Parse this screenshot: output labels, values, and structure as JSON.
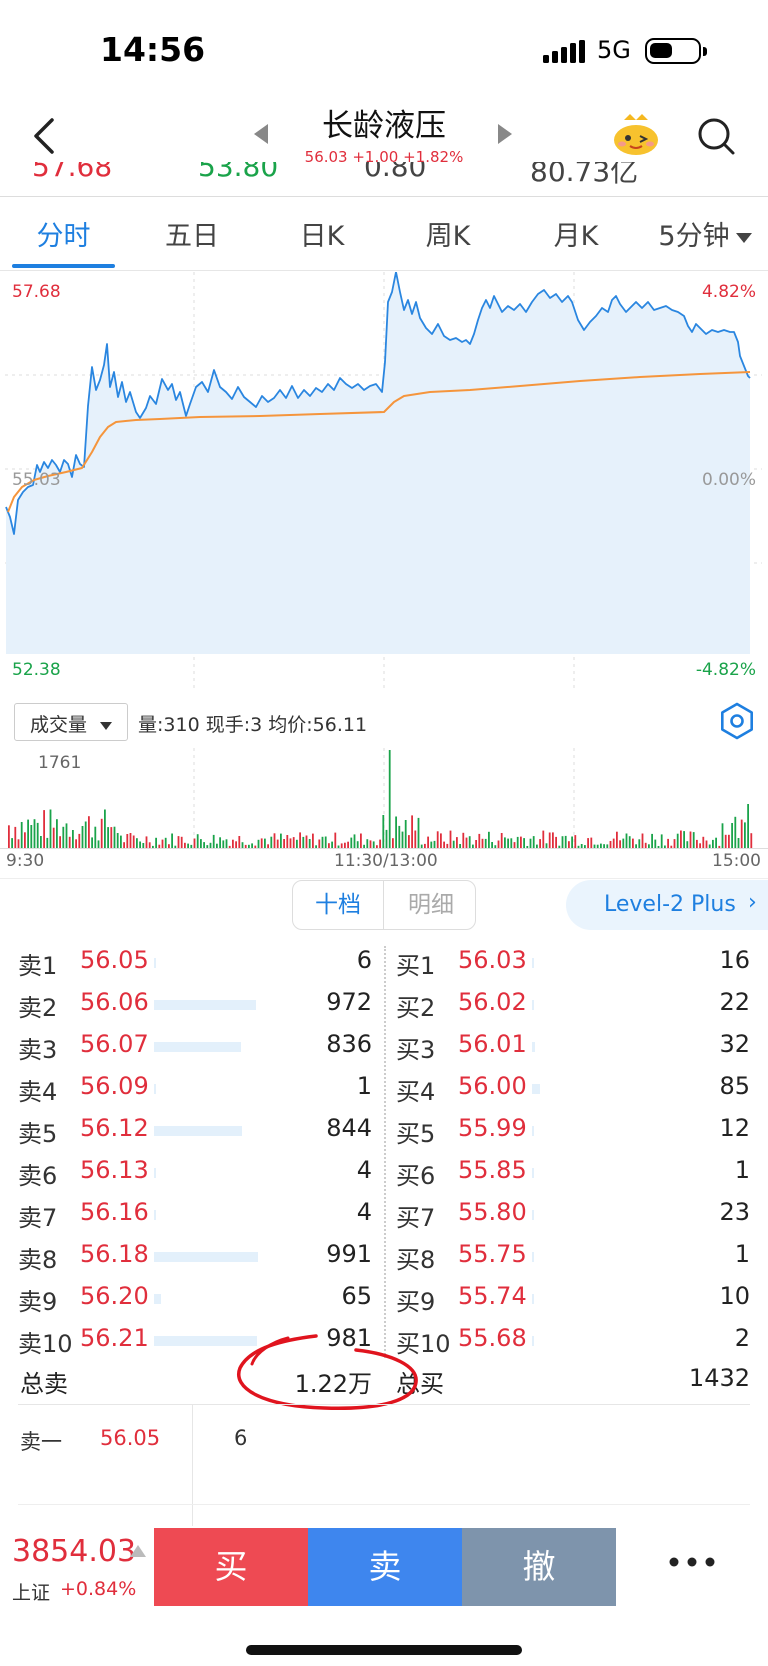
{
  "status_bar": {
    "time": "14:56",
    "network": "5G"
  },
  "header": {
    "title": "长龄液压",
    "subtitle": "56.03 +1.00 +1.82%"
  },
  "quote_row": [
    "57.68",
    "53.80",
    "0.80",
    "80.73亿"
  ],
  "tabs": [
    "分时",
    "五日",
    "日K",
    "周K",
    "月K",
    "5分钟"
  ],
  "chart": {
    "price_top": "57.68",
    "price_mid": "55.03",
    "price_bottom": "52.38",
    "pct_top": "4.82%",
    "pct_mid": "0.00%",
    "pct_bottom": "-4.82%",
    "colors": {
      "price_line": "#2a86e0",
      "avg_line": "#f5953c",
      "fill": "#e6f1fb"
    }
  },
  "indicator": {
    "selector": "成交量",
    "info": "量:310  现手:3  均价:56.11",
    "vol_max": "1761"
  },
  "time_axis": [
    "9:30",
    "11:30/13:00",
    "15:00"
  ],
  "depth_toggle": {
    "active": "十档",
    "inactive": "明细"
  },
  "level2": "Level-2 Plus",
  "order_book": {
    "sell": [
      {
        "label": "卖1",
        "price": "56.05",
        "volume": "6",
        "bar": 0.006
      },
      {
        "label": "卖2",
        "price": "56.06",
        "volume": "972",
        "bar": 0.98
      },
      {
        "label": "卖3",
        "price": "56.07",
        "volume": "836",
        "bar": 0.84
      },
      {
        "label": "卖4",
        "price": "56.09",
        "volume": "1",
        "bar": 0.004
      },
      {
        "label": "卖5",
        "price": "56.12",
        "volume": "844",
        "bar": 0.85
      },
      {
        "label": "卖6",
        "price": "56.13",
        "volume": "4",
        "bar": 0.006
      },
      {
        "label": "卖7",
        "price": "56.16",
        "volume": "4",
        "bar": 0.006
      },
      {
        "label": "卖8",
        "price": "56.18",
        "volume": "991",
        "bar": 1.0
      },
      {
        "label": "卖9",
        "price": "56.20",
        "volume": "65",
        "bar": 0.066
      },
      {
        "label": "卖10",
        "price": "56.21",
        "volume": "981",
        "bar": 0.99
      }
    ],
    "buy": [
      {
        "label": "买1",
        "price": "56.03",
        "volume": "16",
        "bar": 0.02
      },
      {
        "label": "买2",
        "price": "56.02",
        "volume": "22",
        "bar": 0.02
      },
      {
        "label": "买3",
        "price": "56.01",
        "volume": "32",
        "bar": 0.03
      },
      {
        "label": "买4",
        "price": "56.00",
        "volume": "85",
        "bar": 0.08
      },
      {
        "label": "买5",
        "price": "55.99",
        "volume": "12",
        "bar": 0.01
      },
      {
        "label": "买6",
        "price": "55.85",
        "volume": "1",
        "bar": 0.004
      },
      {
        "label": "买7",
        "price": "55.80",
        "volume": "23",
        "bar": 0.02
      },
      {
        "label": "买8",
        "price": "55.75",
        "volume": "1",
        "bar": 0.004
      },
      {
        "label": "买9",
        "price": "55.74",
        "volume": "10",
        "bar": 0.01
      },
      {
        "label": "买10",
        "price": "55.68",
        "volume": "2",
        "bar": 0.004
      }
    ],
    "total_sell_label": "总卖",
    "total_sell": "1.22万",
    "total_buy_label": "总买",
    "total_buy": "1432"
  },
  "detail": {
    "label": "卖一",
    "price": "56.05",
    "volume": "6"
  },
  "bottom_bar": {
    "index_value": "3854.03",
    "index_name": "上证",
    "index_change": "+0.84%",
    "buy": "买",
    "sell": "卖",
    "cancel": "撤"
  }
}
